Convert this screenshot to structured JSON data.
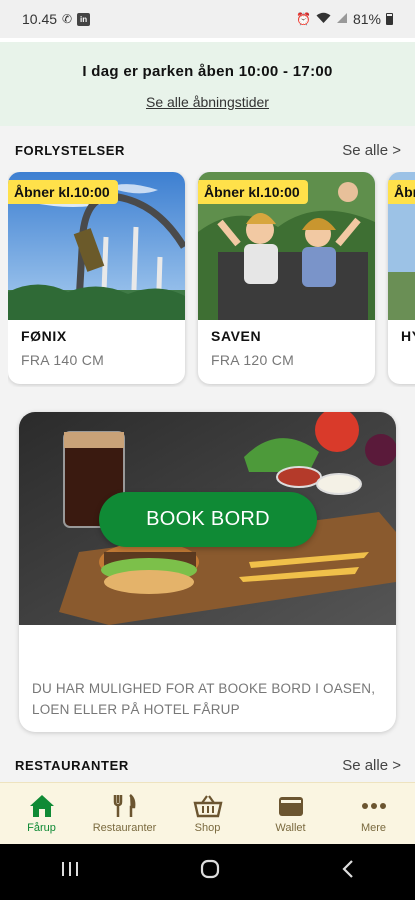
{
  "status_bar": {
    "time": "10.45",
    "battery": "81%"
  },
  "hours_banner": {
    "title": "I dag er parken åben 10:00 - 17:00",
    "link": "Se alle åbningstider"
  },
  "rides_section": {
    "heading": "FORLYSTELSER",
    "see_all": "Se alle >",
    "items": [
      {
        "badge": "Åbner kl.10:00",
        "name": "FØNIX",
        "height": "FRA 140 CM"
      },
      {
        "badge": "Åbner kl.10:00",
        "name": "SAVEN",
        "height": "FRA 120 CM"
      },
      {
        "badge": "Åbr",
        "name": "HY"
      }
    ]
  },
  "booking_card": {
    "button": "BOOK BORD",
    "description": "DU HAR MULIGHED FOR AT BOOKE BORD I OASEN, LOEN ELLER PÅ HOTEL FÅRUP"
  },
  "restaurants_section": {
    "heading": "RESTAURANTER",
    "see_all": "Se alle >"
  },
  "bottom_nav": {
    "items": [
      {
        "label": "Fårup",
        "icon": "home-icon",
        "active": true
      },
      {
        "label": "Restauranter",
        "icon": "cutlery-icon"
      },
      {
        "label": "Shop",
        "icon": "basket-icon"
      },
      {
        "label": "Wallet",
        "icon": "wallet-icon"
      },
      {
        "label": "Mere",
        "icon": "more-icon"
      }
    ]
  },
  "colors": {
    "accent_green": "#0f8a35",
    "badge_yellow": "#ffe14a",
    "nav_bg": "#faf5e1",
    "banner_bg": "#e8f3ea"
  }
}
